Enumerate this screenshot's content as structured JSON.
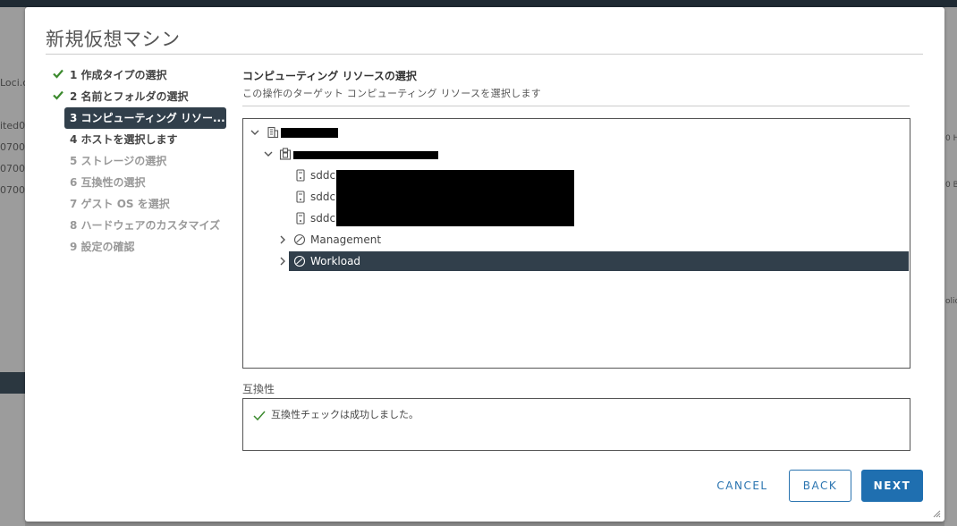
{
  "background": {
    "left_texts": [
      "Loci.c",
      "ited0",
      "0700",
      "0700",
      "0700"
    ],
    "right_texts": [
      "0 H",
      "0 B",
      "olic"
    ]
  },
  "dialog": {
    "title": "新規仮想マシン"
  },
  "steps": [
    {
      "label": "1 作成タイプの選択",
      "state": "done"
    },
    {
      "label": "2 名前とフォルダの選択",
      "state": "done"
    },
    {
      "label": "3 コンピューティング リソー...",
      "state": "active"
    },
    {
      "label": "4 ホストを選択します",
      "state": "pending"
    },
    {
      "label": "5 ストレージの選択",
      "state": "disabled"
    },
    {
      "label": "6 互換性の選択",
      "state": "disabled"
    },
    {
      "label": "7 ゲスト OS を選択",
      "state": "disabled"
    },
    {
      "label": "8 ハードウェアのカスタマイズ",
      "state": "disabled"
    },
    {
      "label": "9 設定の確認",
      "state": "disabled"
    }
  ],
  "content": {
    "title": "コンピューティング リソースの選択",
    "description": "この操作のターゲット コンピューティング リソースを選択します"
  },
  "tree": {
    "hosts": [
      "sddc",
      "sddc",
      "sddc"
    ],
    "pools": [
      {
        "label": "Management",
        "selected": false
      },
      {
        "label": "Workload",
        "selected": true
      }
    ]
  },
  "compatibility": {
    "label": "互換性",
    "message": "互換性チェックは成功しました。"
  },
  "buttons": {
    "cancel": "CANCEL",
    "back": "BACK",
    "next": "NEXT"
  },
  "colors": {
    "accent": "#1f6fb0",
    "check_green": "#3c8a2e",
    "selected_bg": "#313f4b"
  }
}
